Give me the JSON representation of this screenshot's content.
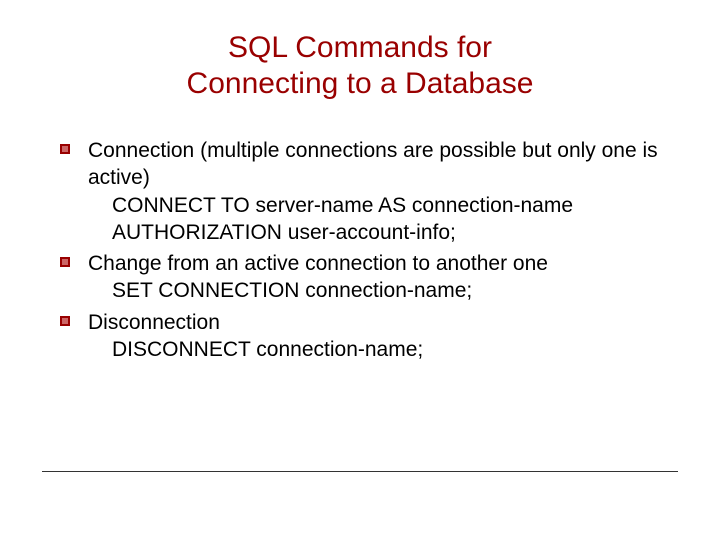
{
  "title_line1": "SQL Commands for",
  "title_line2": "Connecting to a Database",
  "items": [
    {
      "text": "Connection (multiple connections are possible but only one is active)",
      "subs": [
        "CONNECT TO server-name AS connection-name",
        "AUTHORIZATION user-account-info;"
      ]
    },
    {
      "text": "Change from an active connection to another one",
      "subs": [
        "SET CONNECTION connection-name;"
      ]
    },
    {
      "text": "Disconnection",
      "subs": [
        "DISCONNECT connection-name;"
      ]
    }
  ]
}
